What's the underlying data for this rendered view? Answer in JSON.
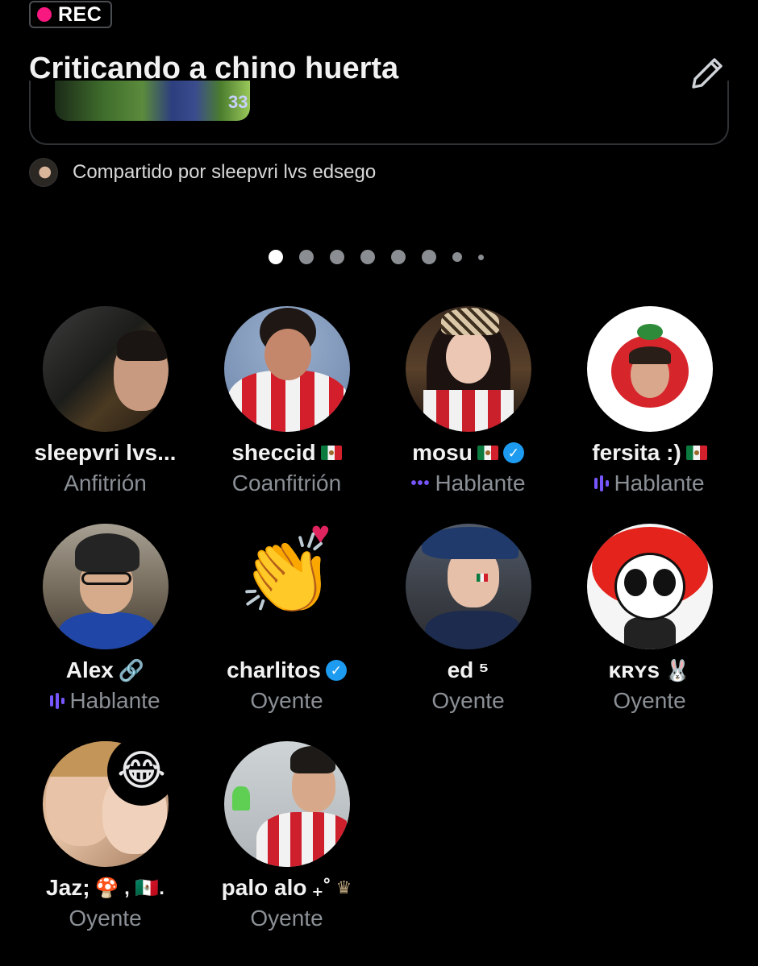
{
  "rec": {
    "label": "REC",
    "color": "#f91880"
  },
  "space": {
    "title": "Criticando a chino huerta",
    "edit_icon": "pencil-icon"
  },
  "media": {
    "jersey_number": "33"
  },
  "shared_by": {
    "text": "Compartido por sleepvri lvs edsego"
  },
  "pager": {
    "count": 8,
    "active_index": 0
  },
  "participants": [
    {
      "name": "sleepvri lvs...",
      "role": "Anfitrión",
      "status": "none"
    },
    {
      "name": "sheccid",
      "suffix": "mexico-flag-emoji",
      "role": "Coanfitrión",
      "status": "none"
    },
    {
      "name": "mosu",
      "suffix": "mexico-flag-emoji",
      "verified": true,
      "role": "Hablante",
      "status": "connecting"
    },
    {
      "name": "fersita :)",
      "suffix": "mexico-flag-emoji",
      "role": "Hablante",
      "status": "speaking"
    },
    {
      "name": "Alex",
      "suffix": "🔗",
      "role": "Hablante",
      "status": "speaking"
    },
    {
      "name": "charlitos",
      "verified": true,
      "role": "Oyente",
      "status": "none",
      "avatar_emoji": "👏"
    },
    {
      "name": "ed",
      "suffix": "⁵",
      "role": "Oyente",
      "status": "none"
    },
    {
      "name": "ᴋʀʏs",
      "suffix": "🐰",
      "role": "Oyente",
      "status": "none"
    },
    {
      "name": "Jaz;",
      "suffix": "🍄 , 🇲🇽.",
      "role": "Oyente",
      "status": "none",
      "avatar_emoji": "😂"
    },
    {
      "name": "palo alo",
      "suffix": "₊˚",
      "role": "Oyente",
      "status": "none"
    }
  ],
  "colors": {
    "accent": "#7856ff",
    "verified": "#1d9bf0",
    "muted_text": "#8b9096"
  }
}
